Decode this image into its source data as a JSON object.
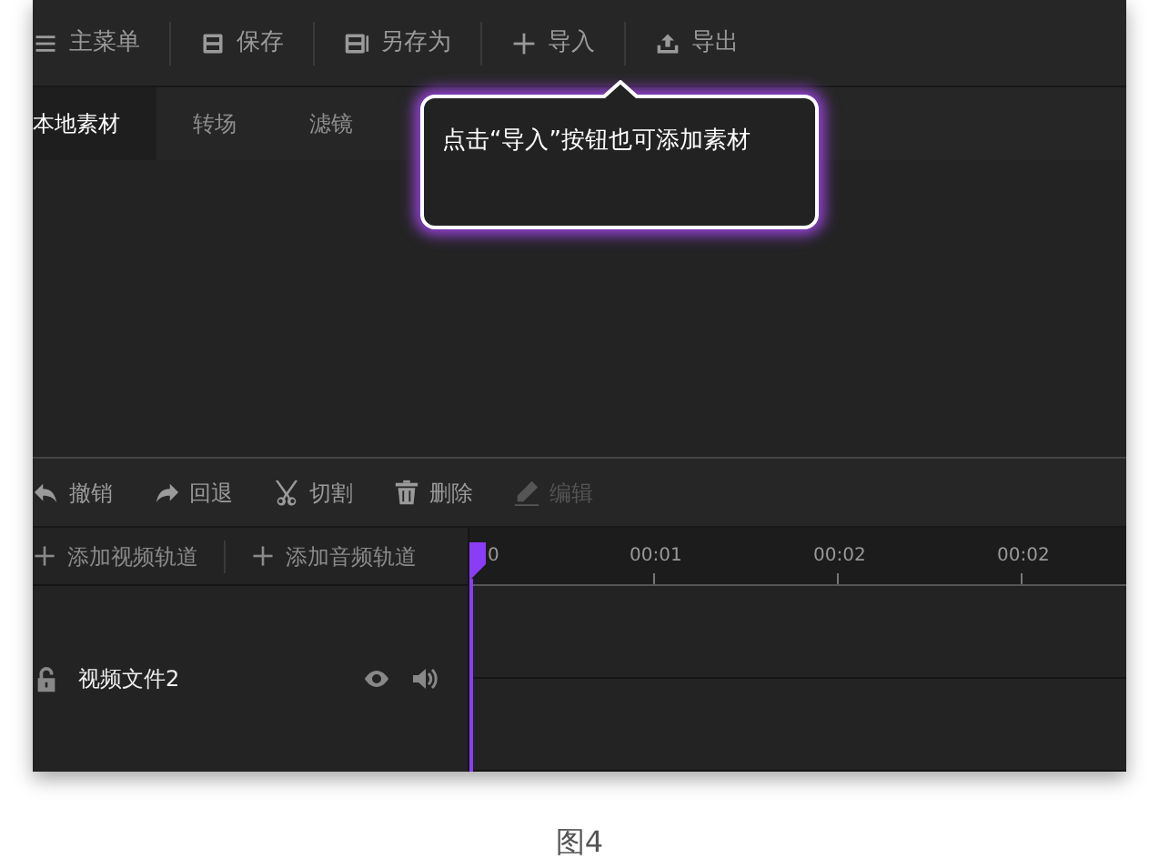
{
  "toolbar": [
    {
      "kind": "menu",
      "label": "主菜单"
    },
    {
      "kind": "save",
      "label": "保存"
    },
    {
      "kind": "saveas",
      "label": "另存为"
    },
    {
      "kind": "import",
      "label": "导入"
    },
    {
      "kind": "export",
      "label": "导出"
    }
  ],
  "tabs": [
    {
      "label": "本地素材",
      "selected": true
    },
    {
      "label": "转场",
      "selected": false
    },
    {
      "label": "滤镜",
      "selected": false
    }
  ],
  "tooltip": {
    "text": "点击“导入”按钮也可添加素材"
  },
  "edit_toolbar": [
    {
      "kind": "undo",
      "label": "撤销",
      "disabled": false
    },
    {
      "kind": "redo",
      "label": "回退",
      "disabled": false
    },
    {
      "kind": "cut",
      "label": "切割",
      "disabled": false
    },
    {
      "kind": "delete",
      "label": "删除",
      "disabled": false
    },
    {
      "kind": "edit",
      "label": "编辑",
      "disabled": true
    }
  ],
  "track_buttons": [
    "添加视频轨道",
    "添加音频轨道"
  ],
  "ruler": [
    "0",
    "00:01",
    "00:02",
    "00:02"
  ],
  "tracks": [
    {
      "name": "视频文件2",
      "locked": false,
      "visible": true,
      "muted": false
    }
  ],
  "caption": "图4"
}
